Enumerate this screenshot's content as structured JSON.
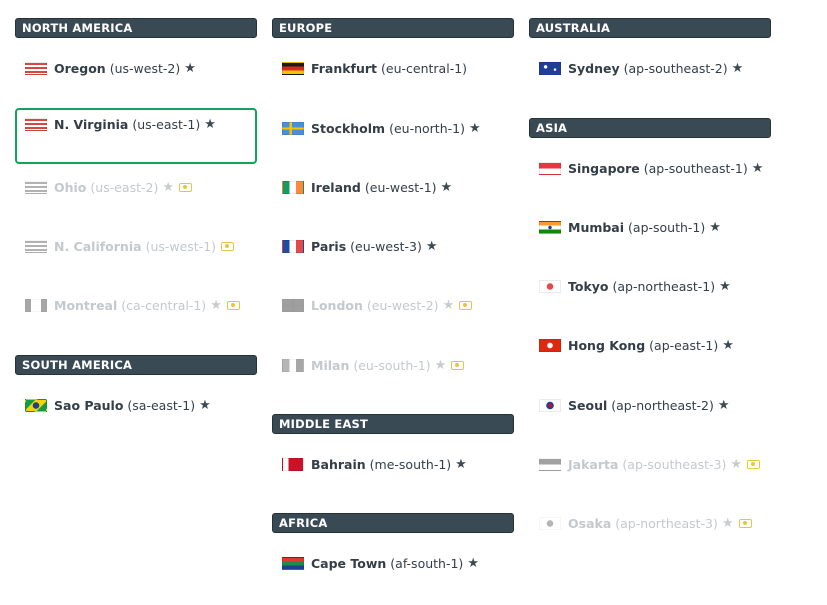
{
  "columns": [
    {
      "sections": [
        {
          "title": "NORTH AMERICA",
          "regions": [
            {
              "name": "Oregon",
              "code": "(us-west-2)",
              "flag": "us",
              "star": true,
              "money": false,
              "state": "enabled"
            },
            {
              "name": "N. Virginia",
              "code": "(us-east-1)",
              "flag": "us",
              "star": true,
              "money": false,
              "state": "selected"
            },
            {
              "name": "Ohio",
              "code": "(us-east-2)",
              "flag": "us",
              "star": true,
              "money": true,
              "state": "disabled"
            },
            {
              "name": "N. California",
              "code": "(us-west-1)",
              "flag": "us",
              "star": false,
              "money": true,
              "state": "disabled"
            },
            {
              "name": "Montreal",
              "code": "(ca-central-1)",
              "flag": "ca",
              "star": true,
              "money": true,
              "state": "disabled"
            }
          ]
        },
        {
          "title": "SOUTH AMERICA",
          "regions": [
            {
              "name": "Sao Paulo",
              "code": "(sa-east-1)",
              "flag": "br",
              "star": true,
              "money": false,
              "state": "enabled"
            }
          ]
        }
      ]
    },
    {
      "sections": [
        {
          "title": "EUROPE",
          "regions": [
            {
              "name": "Frankfurt",
              "code": "(eu-central-1)",
              "flag": "de",
              "star": false,
              "money": false,
              "state": "enabled"
            },
            {
              "name": "Stockholm",
              "code": "(eu-north-1)",
              "flag": "se",
              "star": true,
              "money": false,
              "state": "enabled"
            },
            {
              "name": "Ireland",
              "code": "(eu-west-1)",
              "flag": "ie",
              "star": true,
              "money": false,
              "state": "enabled"
            },
            {
              "name": "Paris",
              "code": "(eu-west-3)",
              "flag": "fr",
              "star": true,
              "money": false,
              "state": "enabled"
            },
            {
              "name": "London",
              "code": "(eu-west-2)",
              "flag": "gb",
              "star": true,
              "money": true,
              "state": "disabled"
            },
            {
              "name": "Milan",
              "code": "(eu-south-1)",
              "flag": "it",
              "star": true,
              "money": true,
              "state": "disabled"
            }
          ]
        },
        {
          "title": "MIDDLE EAST",
          "regions": [
            {
              "name": "Bahrain",
              "code": "(me-south-1)",
              "flag": "bh",
              "star": true,
              "money": false,
              "state": "enabled"
            }
          ]
        },
        {
          "title": "AFRICA",
          "regions": [
            {
              "name": "Cape Town",
              "code": "(af-south-1)",
              "flag": "za",
              "star": true,
              "money": false,
              "state": "enabled"
            }
          ]
        }
      ]
    },
    {
      "sections": [
        {
          "title": "AUSTRALIA",
          "regions": [
            {
              "name": "Sydney",
              "code": "(ap-southeast-2)",
              "flag": "au",
              "star": true,
              "money": false,
              "state": "enabled"
            }
          ]
        },
        {
          "title": "ASIA",
          "regions": [
            {
              "name": "Singapore",
              "code": "(ap-southeast-1)",
              "flag": "sg",
              "star": true,
              "money": false,
              "state": "enabled"
            },
            {
              "name": "Mumbai",
              "code": "(ap-south-1)",
              "flag": "in",
              "star": true,
              "money": false,
              "state": "enabled"
            },
            {
              "name": "Tokyo",
              "code": "(ap-northeast-1)",
              "flag": "jp",
              "star": true,
              "money": false,
              "state": "enabled"
            },
            {
              "name": "Hong Kong",
              "code": "(ap-east-1)",
              "flag": "hk",
              "star": true,
              "money": false,
              "state": "enabled"
            },
            {
              "name": "Seoul",
              "code": "(ap-northeast-2)",
              "flag": "kr",
              "star": true,
              "money": false,
              "state": "enabled"
            },
            {
              "name": "Jakarta",
              "code": "(ap-southeast-3)",
              "flag": "id",
              "star": true,
              "money": true,
              "state": "disabled"
            },
            {
              "name": "Osaka",
              "code": "(ap-northeast-3)",
              "flag": "jp",
              "star": true,
              "money": true,
              "state": "disabled"
            }
          ]
        }
      ]
    }
  ],
  "colors": {
    "header_bg": "#3a4a55",
    "selected_border": "#12a35c",
    "star": "#3e4a52",
    "money": "#e6c640"
  },
  "icons": {
    "star": "star-icon",
    "money": "money-icon"
  }
}
